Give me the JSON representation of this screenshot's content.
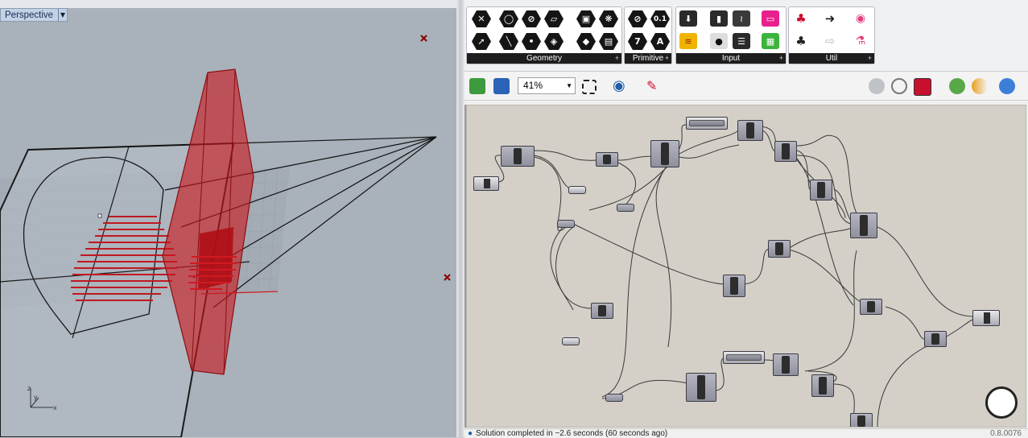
{
  "viewport": {
    "name": "Perspective",
    "axes": {
      "z": "z",
      "y": "y",
      "x": "x"
    }
  },
  "ribbon": {
    "groups": [
      {
        "label": "Geometry"
      },
      {
        "label": "Primitive"
      },
      {
        "label": "Input"
      },
      {
        "label": "Util"
      }
    ],
    "primitive_icons": [
      "0.1",
      "7",
      "A"
    ]
  },
  "toolbar": {
    "zoom": "41%",
    "icons": [
      "open-file-icon",
      "save-file-icon",
      "zoom-extents-icon",
      "preview-eye-icon",
      "sketch-pen-icon",
      "preview-mode-icon",
      "wireframe-icon",
      "shaded-icon",
      "solver-icon",
      "color-icon",
      "sphere-icon"
    ]
  },
  "status": {
    "message": "Solution completed in ~2.6 seconds (60 seconds ago)",
    "version": "0.8.0076"
  },
  "colors": {
    "viewport_bg": "#a9b1ba",
    "accent_red": "#b8141a",
    "canvas_bg": "#d4d0c8",
    "ribbon_label_bg": "#1d1d1d"
  }
}
